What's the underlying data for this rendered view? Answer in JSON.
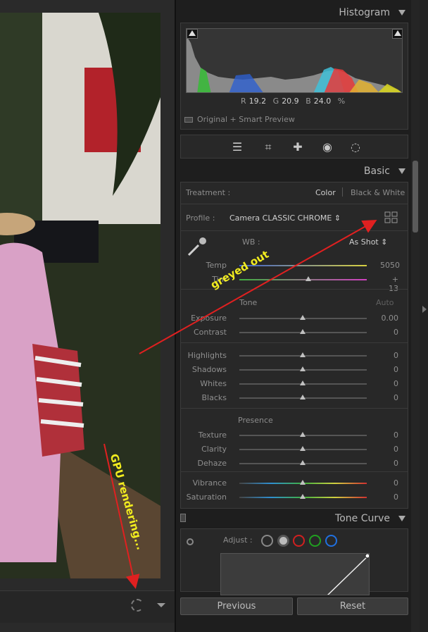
{
  "histogram": {
    "title": "Histogram",
    "r_label": "R",
    "r_value": "19.2",
    "g_label": "G",
    "g_value": "20.9",
    "b_label": "B",
    "b_value": "24.0",
    "unit": "%",
    "preview": "Original + Smart Preview"
  },
  "tools": [
    "sliders-icon",
    "crop-icon",
    "healing-icon",
    "redeye-icon",
    "mask-icon"
  ],
  "basic": {
    "title": "Basic",
    "treatment_label": "Treatment :",
    "treatment_color": "Color",
    "treatment_bw": "Black & White",
    "profile_label": "Profile :",
    "profile_value": "Camera CLASSIC CHROME",
    "wb_label": "WB :",
    "wb_value": "As Shot",
    "tone_label": "Tone",
    "auto_label": "Auto",
    "presence_label": "Presence"
  },
  "sliders": {
    "temp": {
      "label": "Temp",
      "value": "5050"
    },
    "tint": {
      "label": "Tint",
      "value": "+ 13"
    },
    "exposure": {
      "label": "Exposure",
      "value": "0.00"
    },
    "contrast": {
      "label": "Contrast",
      "value": "0"
    },
    "highlights": {
      "label": "Highlights",
      "value": "0"
    },
    "shadows": {
      "label": "Shadows",
      "value": "0"
    },
    "whites": {
      "label": "Whites",
      "value": "0"
    },
    "blacks": {
      "label": "Blacks",
      "value": "0"
    },
    "texture": {
      "label": "Texture",
      "value": "0"
    },
    "clarity": {
      "label": "Clarity",
      "value": "0"
    },
    "dehaze": {
      "label": "Dehaze",
      "value": "0"
    },
    "vibrance": {
      "label": "Vibrance",
      "value": "0"
    },
    "saturation": {
      "label": "Saturation",
      "value": "0"
    }
  },
  "tone_curve": {
    "title": "Tone Curve",
    "adjust_label": "Adjust :"
  },
  "buttons": {
    "previous": "Previous",
    "reset": "Reset"
  },
  "annotations": {
    "greyed_out": "greyed out",
    "gpu_rendering": "GPU rendering..."
  },
  "colors": {
    "annotation_text": "#f1ec1f",
    "annotation_arrow": "#e02020"
  }
}
